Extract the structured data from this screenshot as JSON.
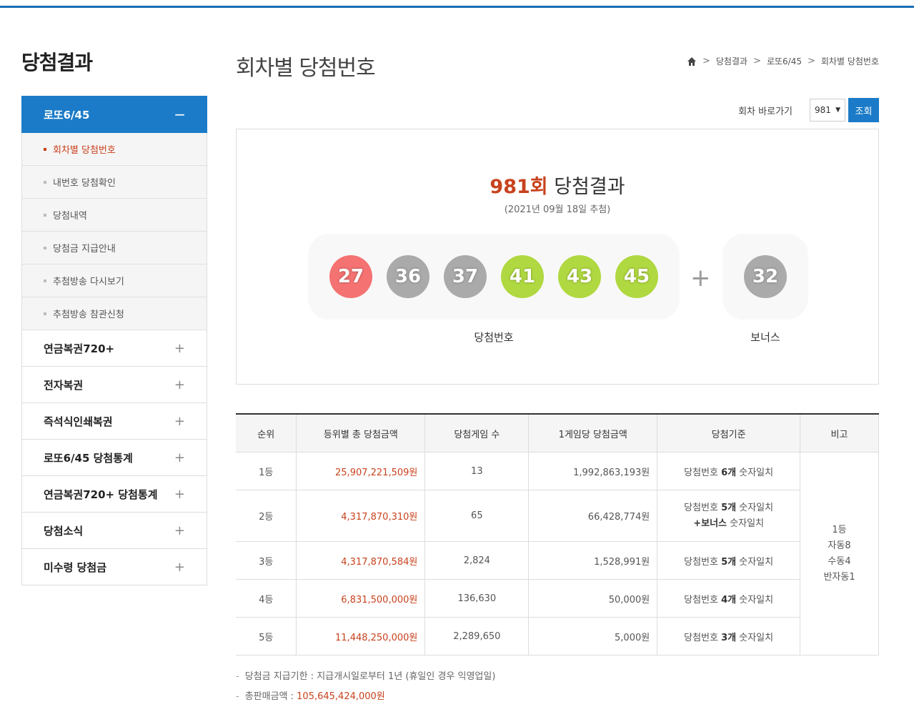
{
  "sidebar": {
    "title": "당첨결과",
    "active": {
      "label": "로또6/45",
      "toggle": "−"
    },
    "sub_items": [
      {
        "label": "회차별 당첨번호",
        "active": true
      },
      {
        "label": "내번호 당첨확인"
      },
      {
        "label": "당첨내역"
      },
      {
        "label": "당첨금 지급안내"
      },
      {
        "label": "추첨방송 다시보기"
      },
      {
        "label": "추첨방송 참관신청"
      }
    ],
    "menu": [
      {
        "label": "연금복권720+",
        "toggle": "+"
      },
      {
        "label": "전자복권",
        "toggle": "+"
      },
      {
        "label": "즉석식인쇄복권",
        "toggle": "+"
      },
      {
        "label": "로또6/45 당첨통계",
        "toggle": "+"
      },
      {
        "label": "연금복권720+ 당첨통계",
        "toggle": "+"
      },
      {
        "label": "당첨소식",
        "toggle": "+"
      },
      {
        "label": "미수령 당첨금",
        "toggle": "+"
      }
    ]
  },
  "header": {
    "title": "회차별 당첨번호",
    "breadcrumb": [
      "당첨결과",
      "로또6/45",
      "회차별 당첨번호"
    ],
    "breadcrumb_sep": ">",
    "home_icon": "home-icon"
  },
  "round_selector": {
    "label": "회차 바로가기",
    "value": "981",
    "arrow": "▼",
    "button": "조회"
  },
  "result": {
    "round": "981회",
    "title_suffix": "당첨결과",
    "date": "(2021년 09월 18일 추첨)",
    "numbers": [
      {
        "value": "27",
        "color": "#f47272"
      },
      {
        "value": "36",
        "color": "#aaaaaa"
      },
      {
        "value": "37",
        "color": "#aaaaaa"
      },
      {
        "value": "41",
        "color": "#b0d840"
      },
      {
        "value": "43",
        "color": "#b0d840"
      },
      {
        "value": "45",
        "color": "#b0d840"
      }
    ],
    "plus": "+",
    "bonus": {
      "value": "32",
      "color": "#aaaaaa"
    },
    "win_label": "당첨번호",
    "bonus_label": "보너스"
  },
  "table": {
    "headers": [
      "순위",
      "등위별 총 당첨금액",
      "당첨게임 수",
      "1게임당 당첨금액",
      "당첨기준",
      "비고"
    ],
    "rows": [
      {
        "rank": "1등",
        "total": "25,907,221,509원",
        "count": "13",
        "per_game": "1,992,863,193원",
        "crit_pre": "당첨번호 ",
        "crit_bold": "6개",
        "crit_post": " 숫자일치"
      },
      {
        "rank": "2등",
        "total": "4,317,870,310원",
        "count": "65",
        "per_game": "66,428,774원",
        "crit_pre": "당첨번호 ",
        "crit_bold": "5개",
        "crit_post": " 숫자일치",
        "crit2_bold": "+보너스",
        "crit2_post": " 숫자일치"
      },
      {
        "rank": "3등",
        "total": "4,317,870,584원",
        "count": "2,824",
        "per_game": "1,528,991원",
        "crit_pre": "당첨번호 ",
        "crit_bold": "5개",
        "crit_post": " 숫자일치"
      },
      {
        "rank": "4등",
        "total": "6,831,500,000원",
        "count": "136,630",
        "per_game": "50,000원",
        "crit_pre": "당첨번호 ",
        "crit_bold": "4개",
        "crit_post": " 숫자일치"
      },
      {
        "rank": "5등",
        "total": "11,448,250,000원",
        "count": "2,289,650",
        "per_game": "5,000원",
        "crit_pre": "당첨번호 ",
        "crit_bold": "3개",
        "crit_post": " 숫자일치"
      }
    ],
    "note_lines": [
      "1등",
      "자동8",
      "수동4",
      "반자동1"
    ]
  },
  "footer": {
    "dash": "-",
    "deadline_label": "당첨금 지급기한 : 지급개시일로부터 1년 (휴일인 경우 익영업일)",
    "sales_label": "총판매금액 : ",
    "sales_value": "105,645,424,000원"
  }
}
